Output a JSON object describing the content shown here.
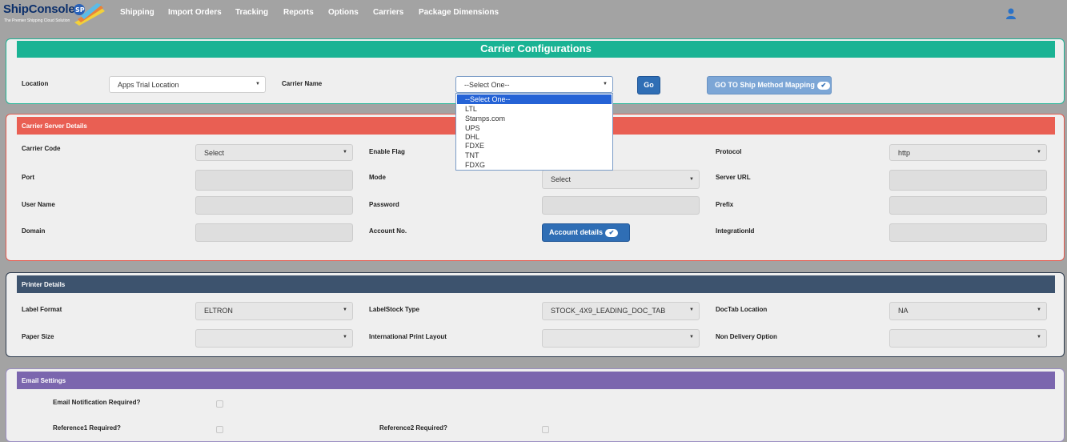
{
  "brand": {
    "name": "ShipConsole",
    "tagline": "The Premier Shipping Cloud Solution"
  },
  "nav": [
    "Shipping",
    "Import Orders",
    "Tracking",
    "Reports",
    "Options",
    "Carriers",
    "Package Dimensions"
  ],
  "top": {
    "title": "Carrier Configurations",
    "location_label": "Location",
    "location_value": "Apps Trial Location",
    "carrier_label": "Carrier Name",
    "carrier_value": "--Select One--",
    "go": "Go",
    "mapping": "GO TO Ship Method Mapping",
    "carrier_options": [
      "--Select One--",
      "LTL",
      "Stamps.com",
      "UPS",
      "DHL",
      "FDXE",
      "TNT",
      "FDXG"
    ]
  },
  "carrier": {
    "title": "Carrier Server Details",
    "carrier_code_label": "Carrier Code",
    "carrier_code_value": "Select",
    "enable_flag_label": "Enable Flag",
    "protocol_label": "Protocol",
    "protocol_value": "http",
    "port_label": "Port",
    "mode_label": "Mode",
    "mode_value": "Select",
    "server_url_label": "Server URL",
    "username_label": "User Name",
    "password_label": "Password",
    "prefix_label": "Prefix",
    "domain_label": "Domain",
    "account_label": "Account No.",
    "account_btn": "Account details",
    "integration_label": "IntegrationId"
  },
  "printer": {
    "title": "Printer Details",
    "label_format_label": "Label Format",
    "label_format_value": "ELTRON",
    "labelstock_label": "LabelStock Type",
    "labelstock_value": "STOCK_4X9_LEADING_DOC_TAB",
    "doctab_label": "DocTab Location",
    "doctab_value": "NA",
    "paper_label": "Paper Size",
    "intl_label": "International Print Layout",
    "nondelivery_label": "Non Delivery Option"
  },
  "email": {
    "title": "Email Settings",
    "notify_label": "Email Notification Required?",
    "ref1_label": "Reference1 Required?",
    "ref2_label": "Reference2 Required?"
  }
}
